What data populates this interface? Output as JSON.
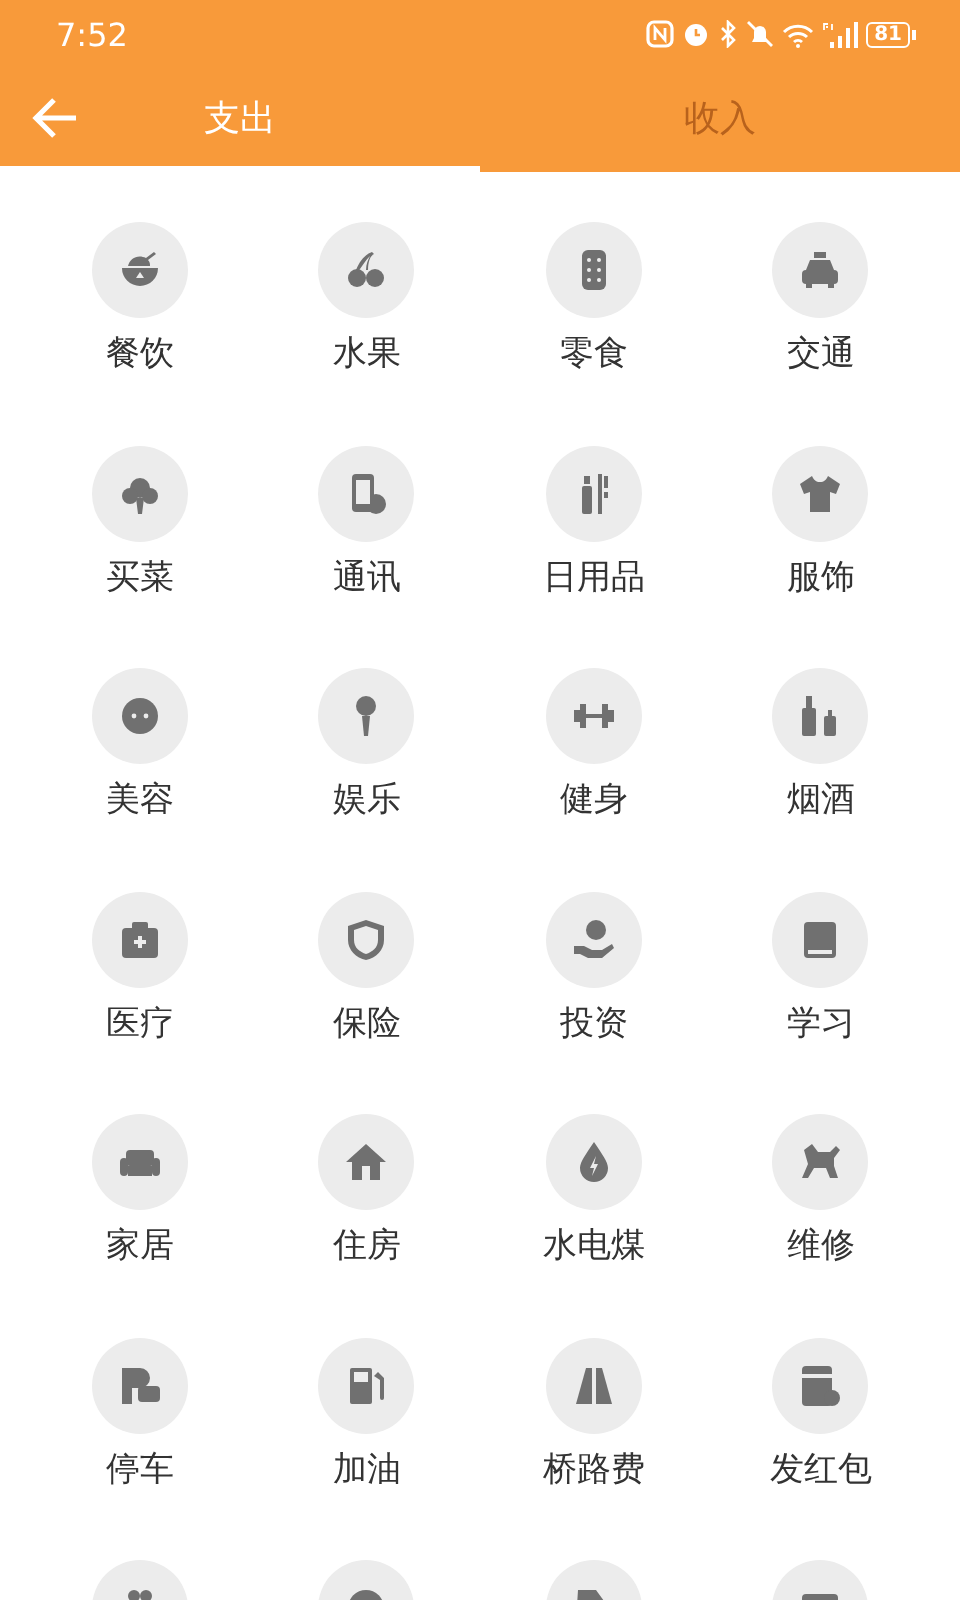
{
  "status_bar": {
    "time": "7:52",
    "battery": "81"
  },
  "tabs": [
    {
      "label": "支出",
      "selected": true
    },
    {
      "label": "收入",
      "selected": false
    }
  ],
  "categories": [
    {
      "kind": "labeled",
      "label": "餐饮"
    },
    {
      "kind": "labeled",
      "label": "水果"
    },
    {
      "kind": "labeled",
      "label": "零食"
    },
    {
      "kind": "labeled",
      "label": "交通"
    },
    {
      "kind": "labeled",
      "label": "买菜"
    },
    {
      "kind": "labeled",
      "label": "通讯"
    },
    {
      "kind": "labeled",
      "label": "日用品"
    },
    {
      "kind": "labeled",
      "label": "服饰"
    },
    {
      "kind": "labeled",
      "label": "美容"
    },
    {
      "kind": "labeled",
      "label": "娱乐"
    },
    {
      "kind": "labeled",
      "label": "健身"
    },
    {
      "kind": "labeled",
      "label": "烟酒"
    },
    {
      "kind": "labeled",
      "label": "医疗"
    },
    {
      "kind": "labeled",
      "label": "保险"
    },
    {
      "kind": "labeled",
      "label": "投资"
    },
    {
      "kind": "labeled",
      "label": "学习"
    },
    {
      "kind": "labeled",
      "label": "家居"
    },
    {
      "kind": "labeled",
      "label": "住房"
    },
    {
      "kind": "labeled",
      "label": "水电煤"
    },
    {
      "kind": "labeled",
      "label": "维修"
    },
    {
      "kind": "labeled",
      "label": "停车"
    },
    {
      "kind": "labeled",
      "label": "加油"
    },
    {
      "kind": "labeled",
      "label": "桥路费"
    },
    {
      "kind": "labeled",
      "label": "发红包"
    },
    {
      "kind": "icon-only"
    },
    {
      "kind": "icon-only"
    },
    {
      "kind": "icon-only"
    },
    {
      "kind": "icon-only"
    }
  ]
}
